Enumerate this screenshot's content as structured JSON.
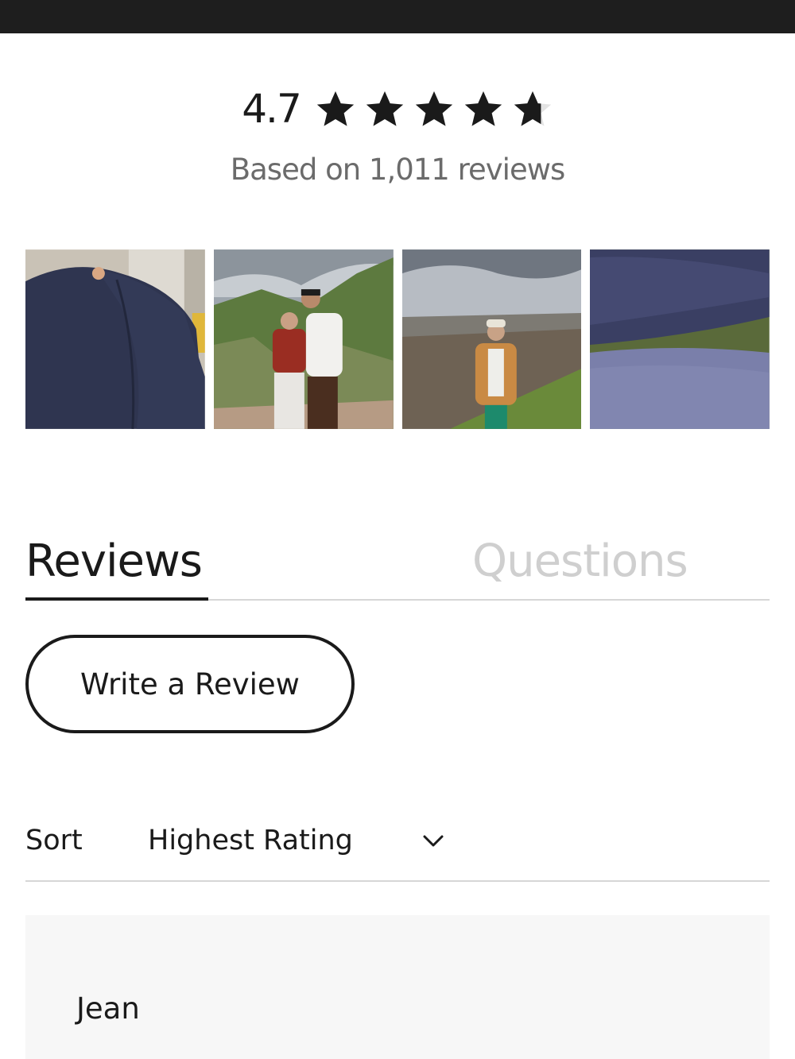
{
  "summary": {
    "rating": "4.7",
    "stars_value": 4.7,
    "stars_max": 5,
    "based_on": "Based on 1,011 reviews"
  },
  "photos": [
    {
      "name": "navy-jacket-shoulder-closeup"
    },
    {
      "name": "couple-on-hiking-trail"
    },
    {
      "name": "woman-at-overlook-in-tan-jacket"
    },
    {
      "name": "navy-fabric-closeup"
    }
  ],
  "tabs": {
    "reviews_label": "Reviews",
    "questions_label": "Questions",
    "active": "reviews"
  },
  "write_review_label": "Write a Review",
  "sort": {
    "label": "Sort",
    "value": "Highest Rating"
  },
  "first_review": {
    "reviewer": "Jean"
  },
  "colors": {
    "star": "#1a1a1a",
    "star_empty": "#e3e3e3",
    "text_secondary": "#6b6b6b",
    "inactive_tab": "#cfcfcf",
    "card_bg": "#f7f7f7",
    "top_bar": "#1e1e1e"
  }
}
